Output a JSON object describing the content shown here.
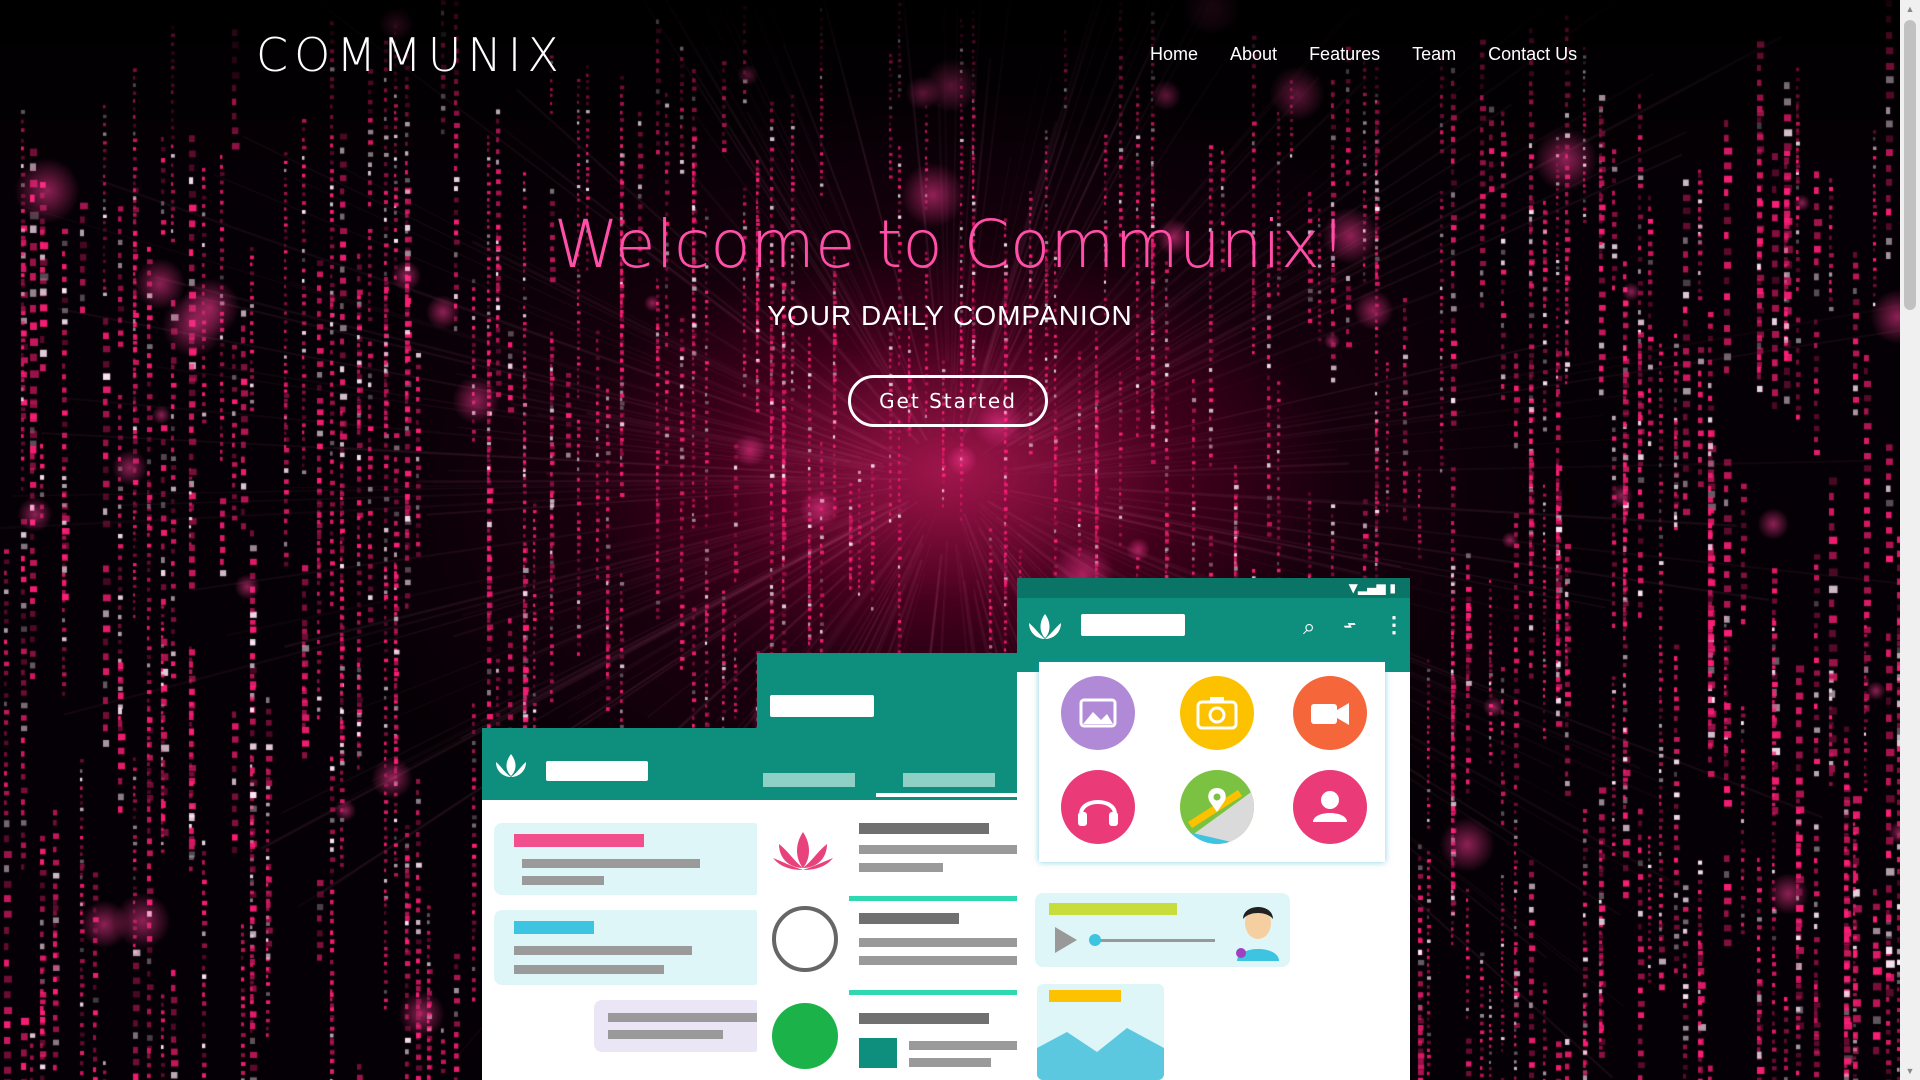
{
  "brand": {
    "logo": "COMMUNIX"
  },
  "nav": {
    "items": [
      {
        "label": "Home"
      },
      {
        "label": "About"
      },
      {
        "label": "Features"
      },
      {
        "label": "Team"
      },
      {
        "label": "Contact Us"
      }
    ]
  },
  "hero": {
    "title": "Welcome to Communix!",
    "subtitle": "YOUR DAILY COMPANION",
    "cta_label": "Get Started"
  },
  "colors": {
    "accent_pink": "#ff4fa8",
    "teal": "#0e8f7e",
    "background": "#000000"
  },
  "illustration": {
    "app_icons": [
      "image-icon",
      "camera-icon",
      "video-icon",
      "headphones-icon",
      "map-pin-icon",
      "user-icon"
    ]
  }
}
